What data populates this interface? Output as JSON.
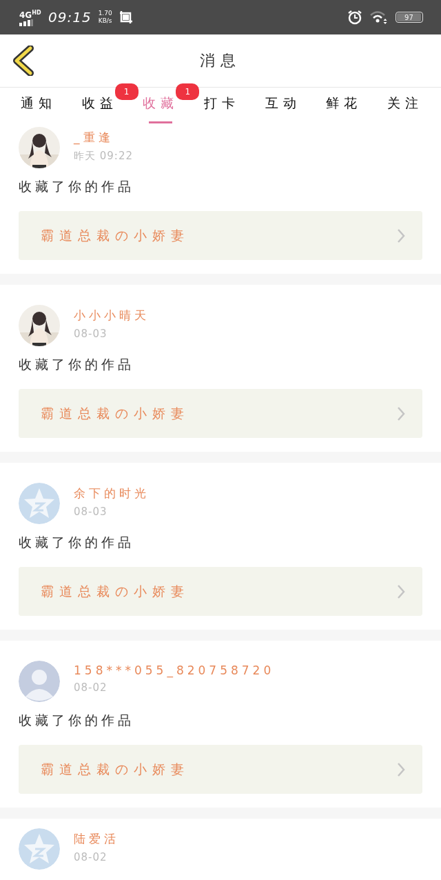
{
  "status_bar": {
    "network": "4G",
    "network_suffix": "HD",
    "time": "09:15",
    "speed_value": "1.70",
    "speed_unit": "KB/s",
    "battery": "97"
  },
  "header": {
    "title": "消息"
  },
  "tabs": [
    {
      "label": "通知",
      "selected": false
    },
    {
      "label": "收益",
      "selected": false,
      "badge": "1"
    },
    {
      "label": "收藏",
      "selected": true,
      "badge": "1"
    },
    {
      "label": "打卡",
      "selected": false
    },
    {
      "label": "互动",
      "selected": false
    },
    {
      "label": "鲜花",
      "selected": false
    },
    {
      "label": "关注",
      "selected": false
    }
  ],
  "messages": [
    {
      "name": "_重逢",
      "time": "昨天 09:22",
      "text": "收藏了你的作品",
      "work": "霸道总裁の小娇妻"
    },
    {
      "name": "小小小晴天",
      "time": "08-03",
      "text": "收藏了你的作品",
      "work": "霸道总裁の小娇妻"
    },
    {
      "avatar": {
        "kind": "star"
      },
      "name": "余下的时光",
      "time": "08-03",
      "text": "收藏了你的作品",
      "work": "霸道总裁の小娇妻"
    },
    {
      "avatar": {
        "kind": "silhouette"
      },
      "name": "158***055_820758720",
      "time": "08-02",
      "text": "收藏了你的作品",
      "work": "霸道总裁の小娇妻"
    },
    {
      "avatar": {
        "kind": "star"
      },
      "name": "陆爱活",
      "time": "08-02"
    }
  ]
}
